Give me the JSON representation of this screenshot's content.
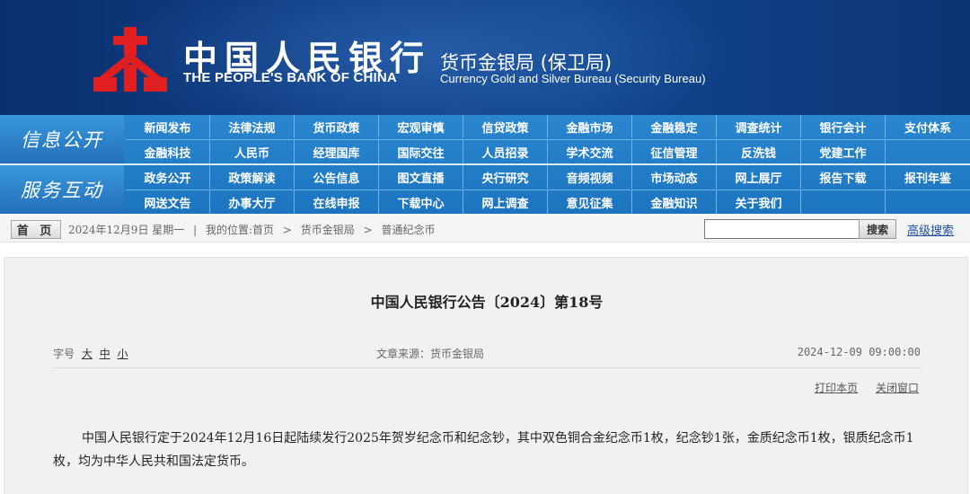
{
  "header": {
    "bank_name_cn": "中国人民银行",
    "bank_name_en": "THE PEOPLE'S BANK OF CHINA",
    "bureau_cn": "货币金银局 (保卫局)",
    "bureau_en": "Currency Gold and Silver Bureau (Security Bureau)",
    "colors": {
      "banner": "#0f3f86",
      "logo": "#e02020",
      "nav": "#1f78c3"
    }
  },
  "nav": {
    "info": {
      "title": "信息公开",
      "row1": [
        "新闻发布",
        "法律法规",
        "货币政策",
        "宏观审慎",
        "信贷政策",
        "金融市场",
        "金融稳定",
        "调查统计",
        "银行会计",
        "支付体系"
      ],
      "row2": [
        "金融科技",
        "人民币",
        "经理国库",
        "国际交往",
        "人员招录",
        "学术交流",
        "征信管理",
        "反洗钱",
        "党建工作",
        ""
      ]
    },
    "service": {
      "title": "服务互动",
      "row1": [
        "政务公开",
        "政策解读",
        "公告信息",
        "图文直播",
        "央行研究",
        "音频视频",
        "市场动态",
        "网上展厅",
        "报告下载",
        "报刊年鉴"
      ],
      "row2": [
        "网送文告",
        "办事大厅",
        "在线申报",
        "下载中心",
        "网上调查",
        "意见征集",
        "金融知识",
        "关于我们",
        "",
        ""
      ]
    }
  },
  "crumb": {
    "home": "首 页",
    "date": "2024年12月9日 星期一",
    "divider": "|",
    "location_label": "我的位置:",
    "path": [
      "首页",
      "货币金银局",
      "普通纪念币"
    ],
    "sep": ">",
    "search_button": "搜索",
    "advanced_search": "高级搜索"
  },
  "article": {
    "title": "中国人民银行公告〔2024〕第18号",
    "font_label": "字号",
    "font_large": "大",
    "font_medium": "中",
    "font_small": "小",
    "source": "文章来源：货币金银局",
    "date": "2024-12-09 09:00:00",
    "print": "打印本页",
    "close": "关闭窗口",
    "body": "中国人民银行定于2024年12月16日起陆续发行2025年贺岁纪念币和纪念钞，其中双色铜合金纪念币1枚，纪念钞1张，金质纪念币1枚，银质纪念币1枚，均为中华人民共和国法定货币。"
  }
}
